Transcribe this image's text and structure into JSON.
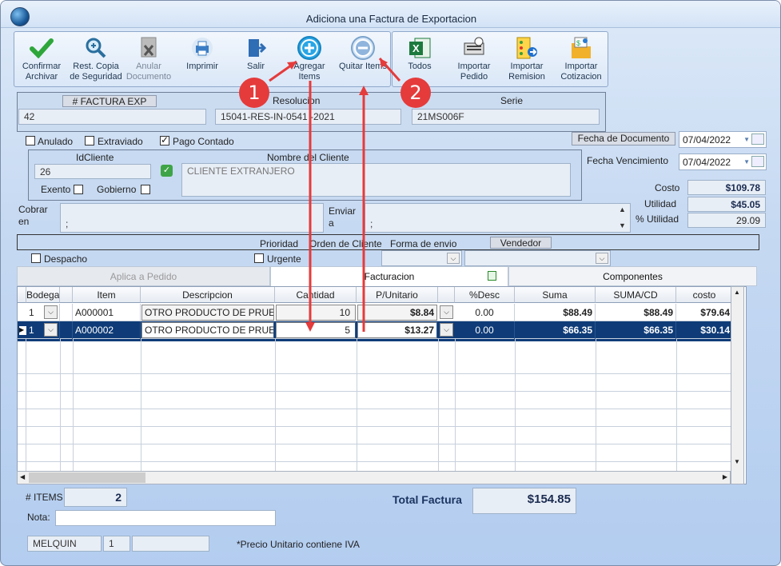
{
  "window": {
    "title": "Adiciona una Factura de Exportacion"
  },
  "toolbar": {
    "confirm": "Confirmar Archivar",
    "restore": "Rest. Copia de Seguridad",
    "annul": "Anular Documento",
    "print": "Imprimir",
    "exit": "Salir",
    "add": "Agregar Items",
    "remove": "Quitar Items",
    "all": "Todos",
    "import_order": "Importar Pedido",
    "import_remission": "Importar Remision",
    "import_quote": "Importar Cotizacion"
  },
  "header": {
    "invoice_label": "# FACTURA EXP",
    "invoice_value": "42",
    "resolution_label": "Resolucion",
    "resolution_value": "15041-RES-IN-0541 -2021",
    "series_label": "Serie",
    "series_value": "21MS006F"
  },
  "flags": {
    "anulado": "Anulado",
    "extraviado": "Extraviado",
    "pago_contado": "Pago Contado",
    "exento": "Exento",
    "gobierno": "Gobierno",
    "despacho": "Despacho",
    "urgente": "Urgente"
  },
  "dates": {
    "doc_label": "Fecha de Documento",
    "doc_value": "07/04/2022",
    "due_label": "Fecha Vencimiento",
    "due_value": "07/04/2022"
  },
  "client": {
    "id_label": "IdCliente",
    "id_value": "26",
    "name_label": "Nombre del Cliente",
    "name_value": "CLIENTE EXTRANJERO"
  },
  "totals_side": {
    "cost_label": "Costo",
    "cost_value": "$109.78",
    "profit_label": "Utilidad",
    "profit_value": "$45.05",
    "pct_label": "% Utilidad",
    "pct_value": "29.09"
  },
  "address": {
    "charge_label": "Cobrar en",
    "charge_value": ";",
    "send_label": "Enviar a",
    "send_value": ";"
  },
  "shipping": {
    "priority": "Prioridad",
    "client_order": "Orden de Cliente",
    "ship_form": "Forma de envio",
    "seller": "Vendedor"
  },
  "tabs": [
    "Aplica a Pedido",
    "Facturacion",
    "Componentes"
  ],
  "grid": {
    "columns": [
      "Bodega",
      "",
      "Item",
      "Descripcion",
      "Cantidad",
      "P/Unitario",
      "",
      "%Desc",
      "Suma",
      "SUMA/CD",
      "costo"
    ],
    "rows": [
      {
        "bodega": "1",
        "item": "A000001",
        "desc": "OTRO PRODUCTO DE PRUE",
        "qty": "10",
        "unit": "$8.84",
        "desc_pct": "0.00",
        "sum": "$88.49",
        "sumcd": "$88.49",
        "cost": "$79.64"
      },
      {
        "bodega": "1",
        "item": "A000002",
        "desc": "OTRO PRODUCTO DE PRUE",
        "qty": "5",
        "unit": "$13.27",
        "desc_pct": "0.00",
        "sum": "$66.35",
        "sumcd": "$66.35",
        "cost": "$30.14"
      }
    ]
  },
  "footer": {
    "items_label": "# ITEMS",
    "items_value": "2",
    "total_label": "Total Factura",
    "total_value": "$154.85",
    "note_label": "Nota:",
    "user": "MELQUIN",
    "user_num": "1",
    "iva_note": "*Precio Unitario contiene IVA"
  },
  "annotations": {
    "one": "1",
    "two": "2"
  }
}
